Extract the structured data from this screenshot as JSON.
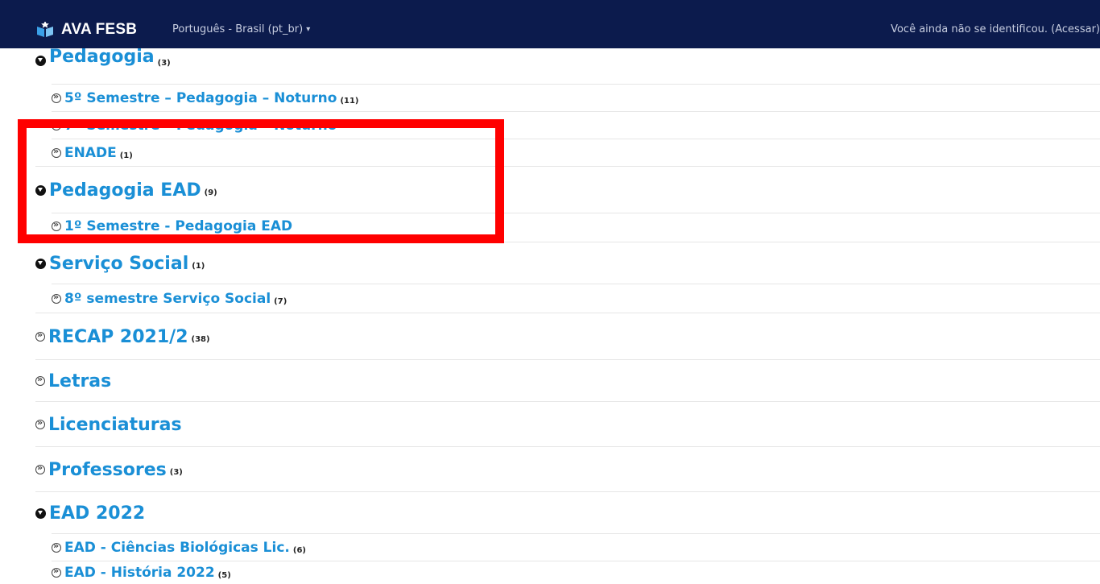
{
  "navbar": {
    "brand": "AVA FESB",
    "language": "Português - Brasil (pt_br)",
    "login_message": "Você ainda não se identificou. (Acessar)"
  },
  "categories": [
    {
      "title": "Pedagogia",
      "count": "(3)"
    },
    {
      "title": "5º Semestre – Pedagogia – Noturno",
      "count": "(11)"
    },
    {
      "title": "7º Semestre – Pedagogia – Noturno",
      "count": ""
    },
    {
      "title": "ENADE",
      "count": "(1)"
    },
    {
      "title": "Pedagogia EAD",
      "count": "(9)"
    },
    {
      "title": "1º Semestre - Pedagogia EAD",
      "count": ""
    },
    {
      "title": "Serviço Social",
      "count": "(1)"
    },
    {
      "title": "8º semestre Serviço Social",
      "count": "(7)"
    },
    {
      "title": "RECAP 2021/2",
      "count": "(38)"
    },
    {
      "title": "Letras",
      "count": ""
    },
    {
      "title": "Licenciaturas",
      "count": ""
    },
    {
      "title": "Professores",
      "count": "(3)"
    },
    {
      "title": "EAD 2022",
      "count": ""
    },
    {
      "title": "EAD - Ciências Biológicas Lic.",
      "count": "(6)"
    },
    {
      "title": "EAD - História 2022",
      "count": "(5)"
    }
  ],
  "colors": {
    "navbar": "#0c1b4d",
    "link": "#1a8fd6",
    "highlight": "#ff0000"
  }
}
